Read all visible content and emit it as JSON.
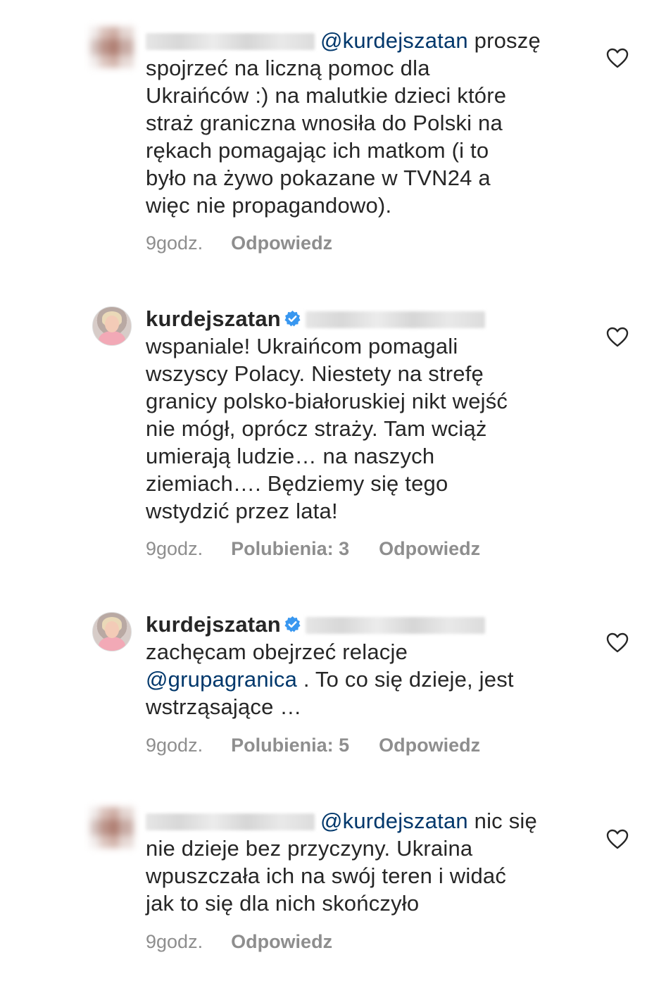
{
  "comments": [
    {
      "id": 1,
      "lines": [
        {
          "mention": "@kurdejszatan",
          "text": " proszę"
        },
        {
          "text": "spojrzeć na liczną pomoc dla"
        },
        {
          "text": "Ukraińców :) na malutkie dzieci które"
        },
        {
          "text": "straż graniczna wnosiła do Polski na"
        },
        {
          "text": "rękach pomagając ich matkom (i to"
        },
        {
          "text": "było na żywo pokazane w TVN24 a"
        },
        {
          "text": "więc nie propagandowo)."
        }
      ],
      "time": "9godz.",
      "reply": "Odpowiedz"
    },
    {
      "id": 2,
      "username": "kurdejszatan",
      "lines": [
        {
          "text": "wspaniale! Ukraińcom pomagali"
        },
        {
          "text": "wszyscy Polacy. Niestety na strefę"
        },
        {
          "text": "granicy polsko-białoruskiej nikt wejść"
        },
        {
          "text": "nie mógł, oprócz straży. Tam wciąż"
        },
        {
          "text": "umierają ludzie… na naszych"
        },
        {
          "text": "ziemiach…. Będziemy się tego"
        },
        {
          "text": "wstydzić przez lata!"
        }
      ],
      "time": "9godz.",
      "likes": "Polubienia: 3",
      "reply": "Odpowiedz"
    },
    {
      "id": 3,
      "username": "kurdejszatan",
      "lines": [
        {
          "text": "zachęcam obejrzeć relacje"
        },
        {
          "mention": "@grupagranica",
          "text": " . To co się dzieje, jest"
        },
        {
          "text": "wstrząsające …"
        }
      ],
      "time": "9godz.",
      "likes": "Polubienia: 5",
      "reply": "Odpowiedz"
    },
    {
      "id": 4,
      "lines": [
        {
          "mention": "@kurdejszatan",
          "text": " nic się"
        },
        {
          "text": "nie dzieje bez przyczyny. Ukraina"
        },
        {
          "text": "wpuszczała ich na swój teren i widać"
        },
        {
          "text": "jak to się dla nich skończyło"
        }
      ],
      "time": "9godz.",
      "reply": "Odpowiedz"
    }
  ],
  "icons": {
    "like": "heart-outline-icon",
    "verified": "verified-badge-icon",
    "verified_color": "#3897f0"
  },
  "colors": {
    "text": "#262626",
    "meta": "#8e8e8e",
    "mention": "#00376b"
  }
}
